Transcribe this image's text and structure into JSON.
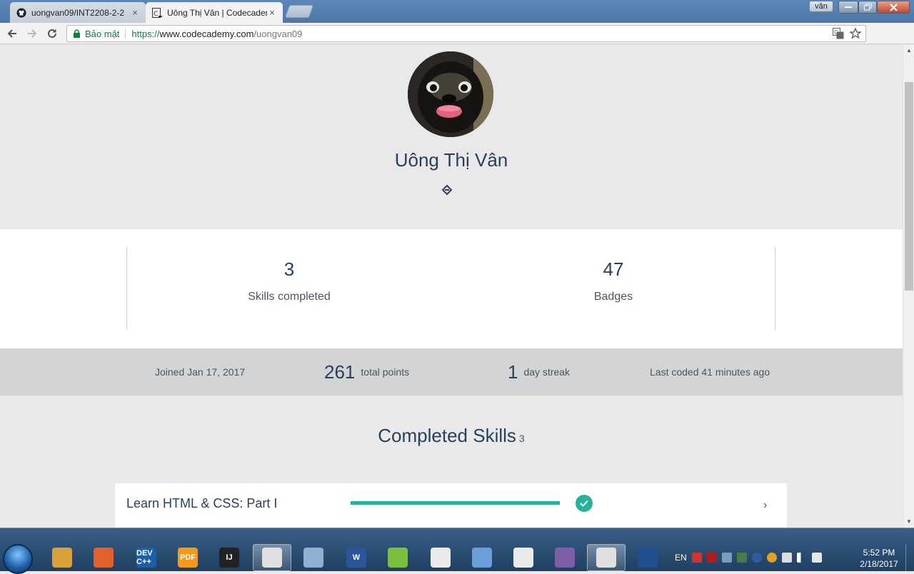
{
  "browser": {
    "tabs": [
      {
        "title": "uongvan09/INT2208-2-2",
        "close": "×",
        "favicon": "github-icon"
      },
      {
        "title": "Uông Thị Vân | Codecademy",
        "close": "×",
        "favicon": "codecademy-icon"
      }
    ],
    "window_user": "vân",
    "address": {
      "secure_label": "Bảo mật",
      "protocol": "https://",
      "host": "www.codecademy.com",
      "path": "/uongvan09"
    }
  },
  "profile": {
    "name": "Uông Thị Vân"
  },
  "stats": {
    "skills_completed": {
      "value": "3",
      "label": "Skills completed"
    },
    "badges": {
      "value": "47",
      "label": "Badges"
    }
  },
  "metrics": {
    "joined": "Joined Jan 17, 2017",
    "points_value": "261",
    "points_label": "total points",
    "streak_value": "1",
    "streak_label": "day streak",
    "last_coded": "Last coded 41 minutes ago"
  },
  "completed_skills": {
    "title": "Completed Skills",
    "count": "3",
    "items": [
      {
        "name": "Learn HTML & CSS: Part I",
        "progress": 1.0,
        "completed": true,
        "chevron": "›"
      }
    ]
  },
  "taskbar": {
    "apps": [
      {
        "icon": "file-explorer-icon",
        "label": ""
      },
      {
        "icon": "media-player-icon",
        "label": ""
      },
      {
        "icon": "dev-cpp-icon",
        "label": "DEV C++"
      },
      {
        "icon": "foxit-pdf-icon",
        "label": "PDF"
      },
      {
        "icon": "intellij-icon",
        "label": "IJ"
      },
      {
        "icon": "chrome-icon",
        "label": ""
      },
      {
        "icon": "paint-icon",
        "label": ""
      },
      {
        "icon": "word-icon",
        "label": "W"
      },
      {
        "icon": "notepad-plus-icon",
        "label": ""
      },
      {
        "icon": "window-app-icon",
        "label": ""
      },
      {
        "icon": "virtualbox-icon",
        "label": ""
      },
      {
        "icon": "window-app-2-icon",
        "label": ""
      },
      {
        "icon": "github-desktop-icon",
        "label": ""
      },
      {
        "icon": "chrome-user-icon",
        "label": ""
      },
      {
        "icon": "powershell-icon",
        "label": ""
      }
    ],
    "language": "EN",
    "time": "5:52 PM",
    "date": "2/18/2017"
  },
  "colors": {
    "accent": "#2bb09a",
    "heading": "#2a3f5a",
    "page_bg": "#e8e9e8",
    "metrics_bg": "#d2d4d6"
  }
}
